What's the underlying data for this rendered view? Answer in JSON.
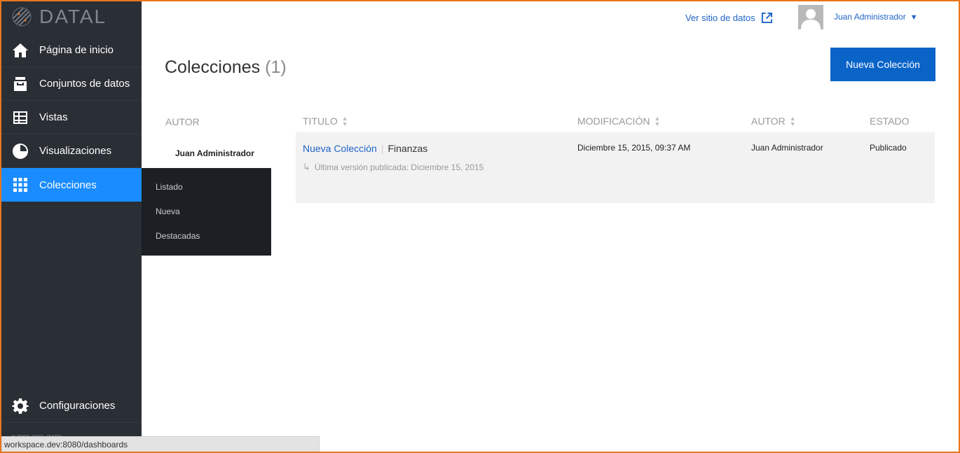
{
  "brand": {
    "name": "DATAL"
  },
  "sidebar": {
    "items": [
      {
        "label": "Página de inicio",
        "icon": "home-icon"
      },
      {
        "label": "Conjuntos de datos",
        "icon": "inbox-icon"
      },
      {
        "label": "Vistas",
        "icon": "table-icon"
      },
      {
        "label": "Visualizaciones",
        "icon": "pie-chart-icon"
      },
      {
        "label": "Colecciones",
        "icon": "grid-icon",
        "active": true
      }
    ],
    "settings": {
      "label": "Configuraciones",
      "icon": "gear-icon"
    },
    "copyright": "© 2009-2015, DATAL"
  },
  "submenu": {
    "items": [
      "Listado",
      "Nueva",
      "Destacadas"
    ]
  },
  "header": {
    "view_site": "Ver sitio de datos",
    "user": "Juan Administrador"
  },
  "page": {
    "title": "Colecciones",
    "count": "(1)",
    "new_button": "Nueva Colección"
  },
  "filter": {
    "heading": "AUTOR",
    "items": [
      "Juan Administrador"
    ]
  },
  "table": {
    "columns": [
      "TITULO",
      "MODIFICACIÓN",
      "AUTOR",
      "ESTADO"
    ],
    "rows": [
      {
        "title": "Nueva Colección",
        "category": "Finanzas",
        "subline": "Última versión publicada: Diciembre 15, 2015",
        "modified": "Diciembre 15, 2015, 09:37 AM",
        "author": "Juan Administrador",
        "status": "Publicado"
      }
    ]
  },
  "statusbar": {
    "url": "workspace.dev:8080/dashboards"
  },
  "colors": {
    "accent": "#1a8cff",
    "button": "#0a64c8",
    "sidebar": "#2a2e35",
    "frame": "#e8761e"
  }
}
